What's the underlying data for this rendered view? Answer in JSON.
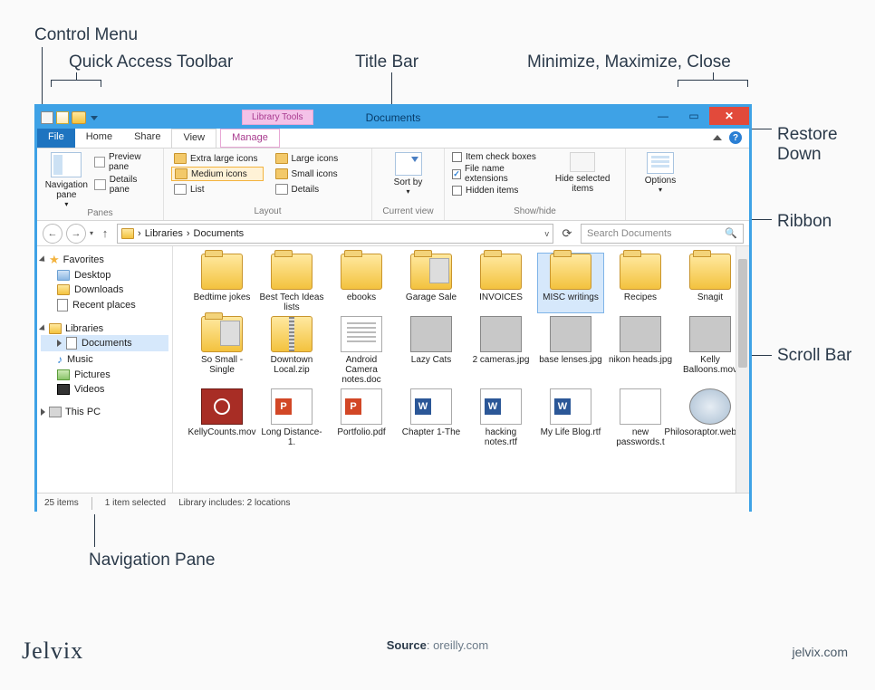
{
  "annotations": {
    "control_menu": "Control Menu",
    "quick_access": "Quick Access Toolbar",
    "title_bar": "Title Bar",
    "min_max_close": "Minimize, Maximize, Close",
    "restore_down": "Restore Down",
    "ribbon": "Ribbon",
    "scroll_bar": "Scroll Bar",
    "navigation_pane": "Navigation Pane"
  },
  "window": {
    "title": "Documents",
    "library_tools": "Library Tools",
    "tabs": {
      "file": "File",
      "home": "Home",
      "share": "Share",
      "view": "View",
      "manage": "Manage"
    },
    "ribbon": {
      "panes": {
        "nav_pane": "Navigation pane",
        "preview_pane": "Preview pane",
        "details_pane": "Details pane",
        "label": "Panes"
      },
      "layout": {
        "extra_large": "Extra large icons",
        "large": "Large icons",
        "medium": "Medium icons",
        "small": "Small icons",
        "list": "List",
        "details": "Details",
        "label": "Layout"
      },
      "current_view": {
        "sort_by": "Sort by",
        "label": "Current view"
      },
      "show_hide": {
        "item_check": "Item check boxes",
        "file_ext": "File name extensions",
        "hidden": "Hidden items",
        "hide_selected": "Hide selected items",
        "label": "Show/hide"
      },
      "options": "Options"
    },
    "breadcrumb": {
      "libs": "Libraries",
      "docs": "Documents"
    },
    "search_placeholder": "Search Documents",
    "nav": {
      "favorites": "Favorites",
      "desktop": "Desktop",
      "downloads": "Downloads",
      "recent": "Recent places",
      "libraries": "Libraries",
      "documents": "Documents",
      "music": "Music",
      "pictures": "Pictures",
      "videos": "Videos",
      "this_pc": "This PC"
    },
    "files": {
      "r1": [
        "Bedtime jokes",
        "Best Tech Ideas lists",
        "ebooks",
        "Garage Sale",
        "INVOICES",
        "MISC writings",
        "Recipes",
        "Snagit"
      ],
      "r2": [
        "So Small - Single",
        "Downtown Local.zip",
        "Android Camera notes.doc",
        "Lazy Cats",
        "2 cameras.jpg",
        "base lenses.jpg",
        "nikon heads.jpg",
        "Kelly Balloons.mov"
      ],
      "r3": [
        "KellyCounts.mov",
        "Long Distance-1.",
        "Portfolio.pdf",
        "Chapter 1-The",
        "hacking notes.rtf",
        "My Life Blog.rtf",
        "new passwords.t",
        "Philosoraptor.webarchi"
      ]
    },
    "status": {
      "count": "25 items",
      "selected": "1 item selected",
      "library": "Library includes: 2 locations"
    }
  },
  "footer": {
    "source_label": "Source",
    "source_val": "oreilly.com",
    "brand": "Jelvix",
    "url": "jelvix.com"
  }
}
